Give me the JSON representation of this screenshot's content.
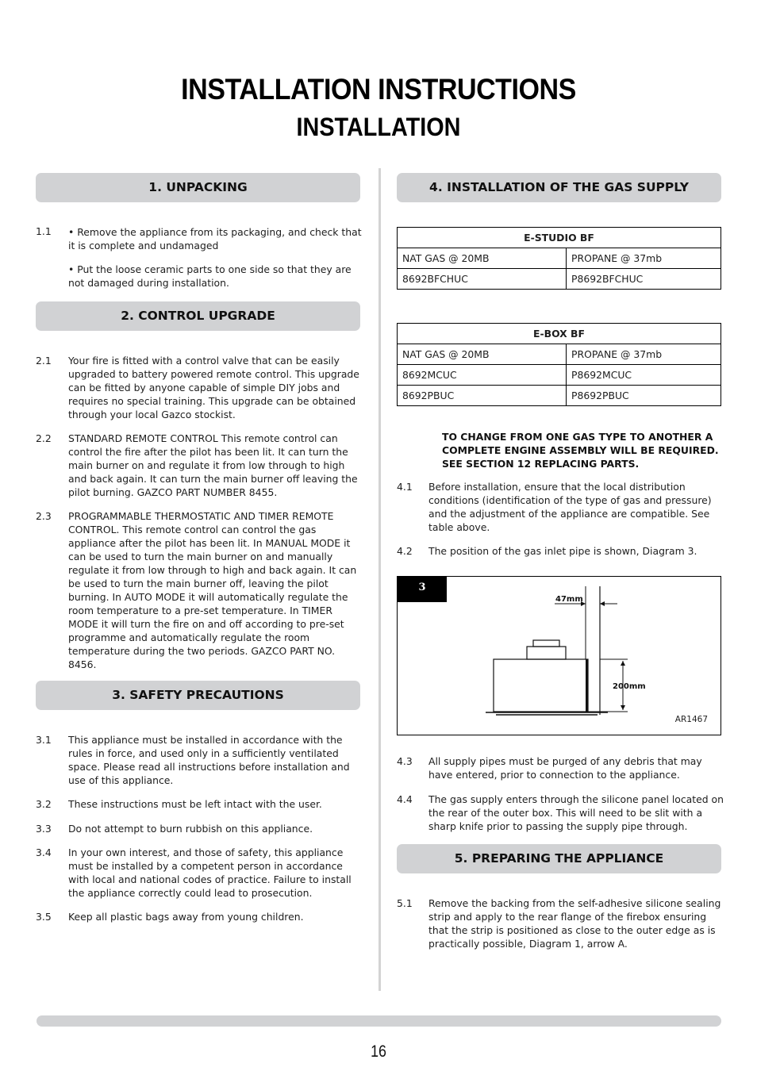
{
  "header": {
    "title": "INSTALLATION INSTRUCTIONS",
    "subtitle": "INSTALLATION"
  },
  "sections": {
    "unpacking": {
      "heading": "1. UNPACKING",
      "num": "1.1",
      "bullets": [
        "•  Remove the appliance from its packaging, and check that it is complete and undamaged",
        "•  Put the loose ceramic parts to one side so that they are not damaged during installation."
      ]
    },
    "control_upgrade": {
      "heading": "2. CONTROL UPGRADE",
      "items": [
        {
          "num": "2.1",
          "text": "Your fire is fitted with a control valve that can be easily upgraded to battery powered remote control. This upgrade can be fitted by anyone capable of simple DIY jobs and requires no special training. This upgrade can be obtained through your local Gazco stockist."
        },
        {
          "num": "2.2",
          "text": "STANDARD REMOTE CONTROL This remote control can control the fire after the pilot has been lit. It can turn the main burner on and regulate it from low through to high and back again. It can turn the main burner off leaving the pilot burning. GAZCO PART NUMBER 8455."
        },
        {
          "num": "2.3",
          "text": "PROGRAMMABLE THERMOSTATIC AND TIMER REMOTE CONTROL. This remote control can control the gas appliance after the pilot has been lit. In MANUAL MODE it can be used to turn the main burner on and manually regulate it from low through to high and back again. It can be used to turn the main burner off, leaving the pilot burning. In AUTO MODE it will automatically regulate the room temperature to a pre-set temperature. In TIMER MODE it will turn the fire on and off according to pre-set programme and automatically regulate the room temperature during the two periods. GAZCO PART NO. 8456."
        }
      ]
    },
    "safety": {
      "heading": "3. SAFETY PRECAUTIONS",
      "items": [
        {
          "num": "3.1",
          "text": "This appliance must be installed in accordance with the rules in force, and used only in a sufficiently ventilated space. Please read all instructions before installation and use of this appliance."
        },
        {
          "num": "3.2",
          "text": "These instructions must be left intact with the user."
        },
        {
          "num": "3.3",
          "text": "Do not attempt to burn rubbish on this appliance."
        },
        {
          "num": "3.4",
          "text": "In your own interest, and those of safety, this appliance must be installed by a competent person in accordance with local and national codes of practice. Failure to install the appliance correctly could lead to prosecution."
        },
        {
          "num": "3.5",
          "text": "Keep all plastic bags away from young children."
        }
      ]
    },
    "gas_supply": {
      "heading": "4. INSTALLATION OF THE GAS SUPPLY",
      "tables": [
        {
          "title": "E-STUDIO BF",
          "columns": [
            "NAT GAS @ 20MB",
            "PROPANE @ 37mb"
          ],
          "rows": [
            [
              "8692BFCHUC",
              "P8692BFCHUC"
            ]
          ]
        },
        {
          "title": "E-BOX BF",
          "columns": [
            "NAT GAS @ 20MB",
            "PROPANE @ 37mb"
          ],
          "rows": [
            [
              "8692MCUC",
              "P8692MCUC"
            ],
            [
              "8692PBUC",
              "P8692PBUC"
            ]
          ]
        }
      ],
      "notice": "TO CHANGE FROM ONE GAS TYPE TO ANOTHER A COMPLETE ENGINE ASSEMBLY WILL BE REQUIRED. SEE SECTION 12 REPLACING PARTS.",
      "items": [
        {
          "num": "4.1",
          "text": "Before installation, ensure that the local distribution conditions (identification of the type of gas and pressure) and the adjustment of the appliance are compatible. See table above."
        },
        {
          "num": "4.2",
          "text": "The position of the gas inlet pipe is shown, Diagram 3."
        },
        {
          "num": "4.3",
          "text": "All supply pipes must be purged of any debris that may have entered, prior to connection to the appliance."
        },
        {
          "num": "4.4",
          "text": "The gas supply enters through the silicone panel located on the rear of the outer box. This will need to be slit with a sharp knife prior to passing the supply pipe through."
        }
      ],
      "diagram": {
        "number": "3",
        "label_width": "47mm",
        "label_height": "200mm",
        "ref": "AR1467"
      }
    },
    "preparing": {
      "heading": "5. PREPARING THE APPLIANCE",
      "items": [
        {
          "num": "5.1",
          "text": "Remove the backing from the self-adhesive silicone sealing strip and apply to the rear flange of the firebox ensuring that the strip is positioned as close to the outer edge as is practically possible, Diagram 1, arrow A."
        }
      ]
    }
  },
  "footer": {
    "page_number": "16"
  }
}
